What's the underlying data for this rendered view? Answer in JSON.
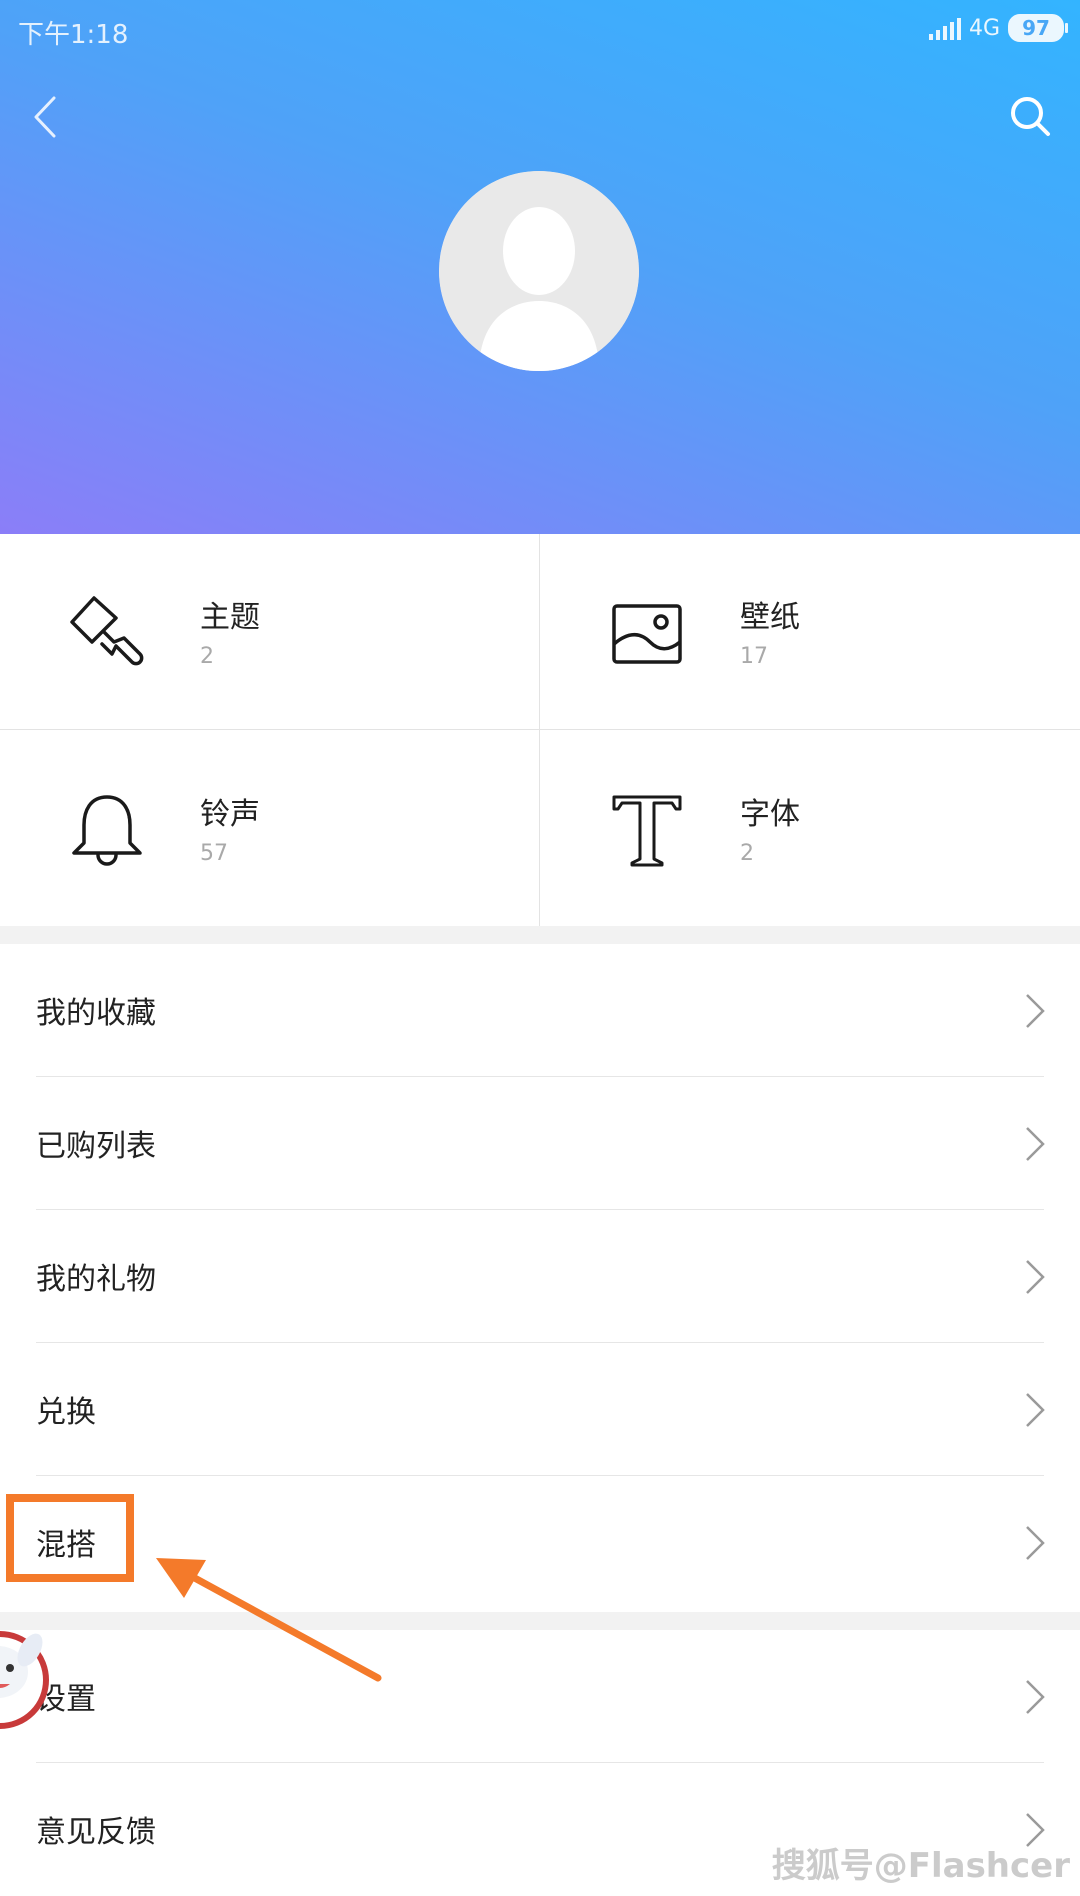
{
  "status_bar": {
    "time": "下午1:18",
    "network": "4G",
    "battery": "97"
  },
  "header": {
    "gradient_colors": [
      "#33b4ff",
      "#8b7ef8"
    ],
    "back_icon": "chevron-left-icon",
    "search_icon": "search-icon",
    "avatar": "default-avatar"
  },
  "categories": [
    {
      "label": "主题",
      "count": "2",
      "icon": "paint-brush-icon"
    },
    {
      "label": "壁纸",
      "count": "17",
      "icon": "wallpaper-image-icon"
    },
    {
      "label": "铃声",
      "count": "57",
      "icon": "bell-icon"
    },
    {
      "label": "字体",
      "count": "2",
      "icon": "font-t-icon"
    }
  ],
  "menu_group_1": [
    {
      "label": "我的收藏"
    },
    {
      "label": "已购列表"
    },
    {
      "label": "我的礼物"
    },
    {
      "label": "兑换"
    },
    {
      "label": "混搭"
    }
  ],
  "menu_group_2": [
    {
      "label": "设置"
    },
    {
      "label": "意见反馈"
    }
  ],
  "annotation": {
    "highlight_color": "#f47a2a",
    "highlighted_item": "混搭"
  },
  "watermark": "搜狐号@Flashcer"
}
